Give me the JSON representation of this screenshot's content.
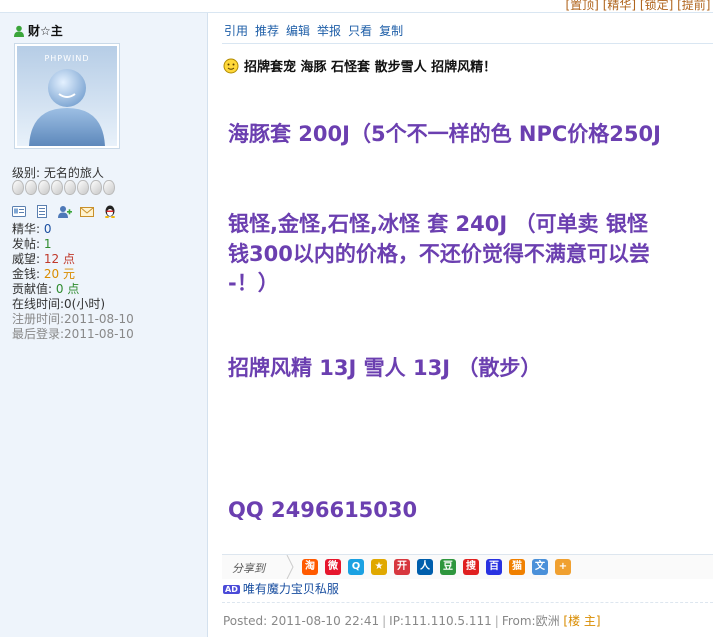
{
  "top_links": [
    "[置顶]",
    "[精华]",
    "[锁定]",
    "[提前]",
    "["
  ],
  "user": {
    "name": "财☆主",
    "avatar_text": "PHPWIND",
    "level_label": "级别:",
    "level_value": "无名的旅人",
    "stats": [
      {
        "label": "精华:",
        "value": "0",
        "color": "blue"
      },
      {
        "label": "发帖:",
        "value": "1",
        "color": "green"
      },
      {
        "label": "威望:",
        "value": "12 点",
        "color": "red"
      },
      {
        "label": "金钱:",
        "value": "20 元",
        "color": "orange"
      },
      {
        "label": "贡献值:",
        "value": "0 点",
        "color": "green"
      },
      {
        "label": "在线时间:",
        "value": "0(小时)",
        "color": "dark"
      }
    ],
    "register_label": "注册时间:",
    "register_value": "2011-08-10",
    "last_login_label": "最后登录:",
    "last_login_value": "2011-08-10"
  },
  "actions": [
    "引用",
    "推荐",
    "编辑",
    "举报",
    "只看",
    "复制"
  ],
  "post": {
    "title": "招牌套宠 海豚 石怪套 散步雪人 招牌风精！",
    "lines": [
      "海豚套  200J（5个不一样的色  NPC价格250J",
      "银怪,金怪,石怪,冰怪  套  240J （可单卖  银怪",
      "钱300以内的价格，不还价觉得不满意可以尝",
      "-！）",
      "招牌风精  13J        雪人  13J （散步）",
      "QQ   2496615030"
    ]
  },
  "share": {
    "label": "分享到",
    "icons": [
      {
        "name": "taobao-icon",
        "glyph": "淘",
        "color": "#ff5a00"
      },
      {
        "name": "weibo-icon",
        "glyph": "微",
        "color": "#e6162d"
      },
      {
        "name": "qzone-icon",
        "glyph": "Q",
        "color": "#1ba1e2"
      },
      {
        "name": "star-icon",
        "glyph": "★",
        "color": "#e0a800"
      },
      {
        "name": "kaixin-icon",
        "glyph": "开",
        "color": "#d7373e"
      },
      {
        "name": "renren-icon",
        "glyph": "人",
        "color": "#005eac"
      },
      {
        "name": "douban-icon",
        "glyph": "豆",
        "color": "#2e963d"
      },
      {
        "name": "sohu-icon",
        "glyph": "搜",
        "color": "#e02020"
      },
      {
        "name": "baidu-icon",
        "glyph": "百",
        "color": "#2932e1"
      },
      {
        "name": "mop-icon",
        "glyph": "猫",
        "color": "#f08000"
      },
      {
        "name": "doc-icon",
        "glyph": "文",
        "color": "#4a90d9"
      },
      {
        "name": "more-icon",
        "glyph": "+",
        "color": "#f0a030"
      }
    ]
  },
  "ad": {
    "badge": "AD",
    "text": "唯有魔力宝贝私服"
  },
  "footer": {
    "posted": "Posted: 2011-08-10 22:41",
    "ip": "IP:111.110.5.111",
    "from": "From:欧洲",
    "floor": "[楼 主]"
  },
  "colors": {
    "post_text": "#6b3fb0",
    "link": "#1f5fa8",
    "sidebar_bg": "#eef4fb"
  }
}
